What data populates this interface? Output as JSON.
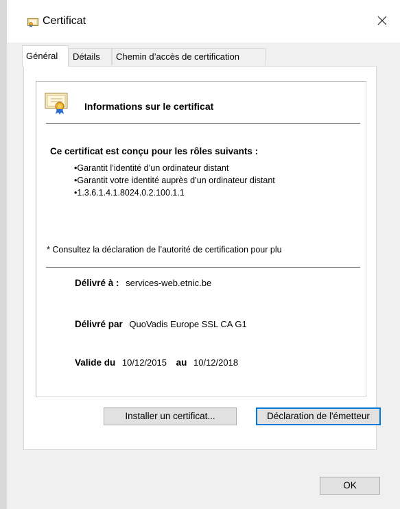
{
  "window": {
    "title": "Certificat",
    "accent": "#0078d7"
  },
  "tabs": [
    {
      "label": "Général",
      "active": true
    },
    {
      "label": "Détails",
      "active": false
    },
    {
      "label": "Chemin d’accès de certification",
      "active": false
    }
  ],
  "info": {
    "heading": "Informations sur le certificat",
    "purposes_title": "Ce certificat est conçu pour les rôles suivants :",
    "purposes": [
      "Garantit l’identité d’un ordinateur distant",
      "Garantit votre identité auprès d’un ordinateur distant",
      "1.3.6.1.4.1.8024.0.2.100.1.1"
    ],
    "note": "* Consultez la déclaration de l’autorité de certification pour plu"
  },
  "fields": {
    "issued_to_label": "Délivré à :",
    "issued_to_value": "services-web.etnic.be",
    "issued_by_label": "Délivré par",
    "issued_by_value": "QuoVadis Europe SSL CA G1",
    "valid_from_label": "Valide du",
    "valid_from_value": "10/12/2015",
    "valid_to_label": "au",
    "valid_to_value": "10/12/2018"
  },
  "buttons": {
    "install": "Installer un certificat...",
    "issuer_statement": "Déclaration de l'émetteur",
    "ok": "OK"
  },
  "icons": {
    "title": "certificate-icon",
    "close": "close-icon",
    "cert": "certificate-icon"
  }
}
